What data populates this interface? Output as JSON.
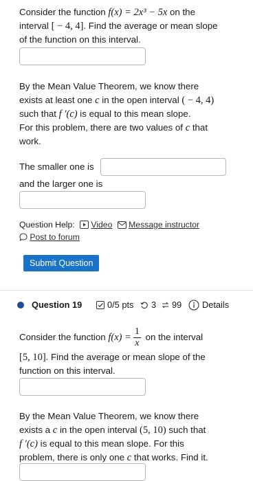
{
  "q18": {
    "intro_a": "Consider the function",
    "func": "f(x) = 2x³ − 5x",
    "intro_b": "on the",
    "intro_c": "interval",
    "interval": "[ − 4, 4]",
    "intro_d": ". Find the average or mean slope",
    "intro_e": "of the function on this interval.",
    "mvt_1": "By the Mean Value Theorem, we know there",
    "mvt_2a": "exists at least one",
    "mvt_2c": "c",
    "mvt_2b": "in the open interval",
    "open_interval": "( − 4, 4)",
    "mvt_3a": "such that",
    "fprime": "f ′(c)",
    "mvt_3b": "is equal to this mean slope.",
    "mvt_4a": "For this problem, there are two values of",
    "mvt_4c": "c",
    "mvt_4b": "that",
    "mvt_5": "work.",
    "smaller_label": "The smaller one is",
    "larger_label": "and the larger one is",
    "help_label": "Question Help:",
    "video_label": "Video",
    "message_label": "Message instructor",
    "forum_label": "Post to forum",
    "submit_label": "Submit Question"
  },
  "q19": {
    "title": "Question 19",
    "pts": "0/5 pts",
    "retries": "3",
    "attempts": "99",
    "details_label": "Details",
    "intro_a": "Consider the function",
    "func_lhs": "f(x) =",
    "frac_num": "1",
    "frac_den": "x",
    "intro_b": "on the interval",
    "interval": "[5, 10]",
    "intro_c": ". Find the average or mean slope of the",
    "intro_d": "function on this interval.",
    "mvt_1": "By the Mean Value Theorem, we know there",
    "mvt_2a": "exists a",
    "mvt_2c": "c",
    "mvt_2b": "in the open interval",
    "open_interval": "(5, 10)",
    "mvt_2d": "such that",
    "fprime": "f ′(c)",
    "mvt_3": "is equal to this mean slope. For this",
    "mvt_4a": "problem, there is only one",
    "mvt_4c": "c",
    "mvt_4b": "that works. Find it."
  },
  "colors": {
    "accent": "#1a73c9",
    "bullet": "#1a4fa0"
  },
  "icons": [
    "video-icon",
    "mail-icon",
    "forum-icon",
    "pts-check-icon",
    "retry-icon",
    "attempts-icon",
    "info-icon"
  ]
}
